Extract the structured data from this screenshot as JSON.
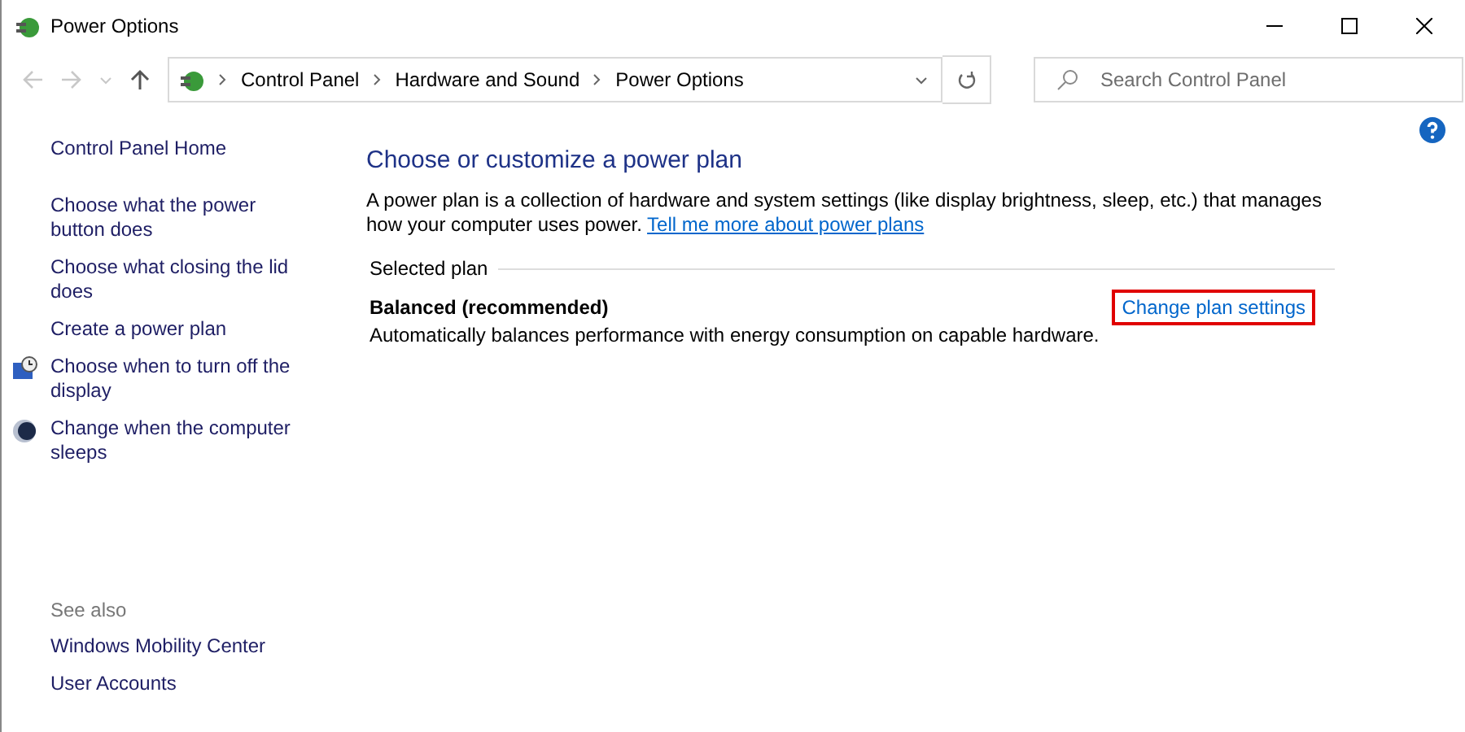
{
  "window": {
    "title": "Power Options"
  },
  "nav": {
    "back_disabled": true,
    "forward_disabled": true,
    "breadcrumb": [
      "Control Panel",
      "Hardware and Sound",
      "Power Options"
    ]
  },
  "search": {
    "placeholder": "Search Control Panel"
  },
  "sidebar": {
    "home": "Control Panel Home",
    "items": [
      {
        "label": "Choose what the power button does",
        "kind": "plain"
      },
      {
        "label": "Choose what closing the lid does",
        "kind": "plain"
      },
      {
        "label": "Create a power plan",
        "kind": "plain"
      },
      {
        "label": "Choose when to turn off the display",
        "kind": "display"
      },
      {
        "label": "Change when the computer sleeps",
        "kind": "sleep"
      }
    ],
    "see_also": {
      "heading": "See also",
      "items": [
        "Windows Mobility Center",
        "User Accounts"
      ]
    }
  },
  "main": {
    "heading": "Choose or customize a power plan",
    "description": "A power plan is a collection of hardware and system settings (like display brightness, sleep, etc.) that manages how your computer uses power.",
    "learn_link": "Tell me more about power plans",
    "section": "Selected plan",
    "plan": {
      "name": "Balanced (recommended)",
      "summary": "Automatically balances performance with energy consumption on capable hardware.",
      "link": "Change plan settings",
      "highlighted": true
    }
  }
}
